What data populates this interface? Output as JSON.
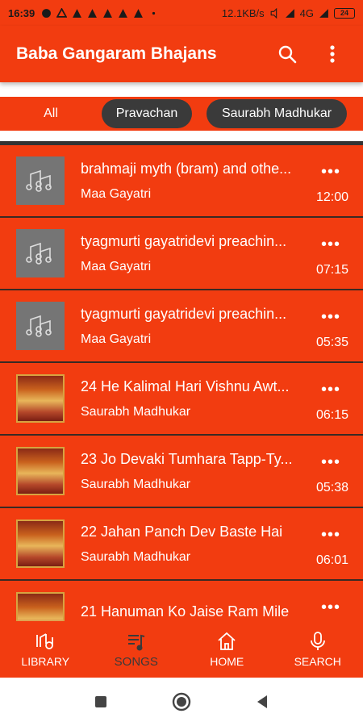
{
  "status": {
    "time": "16:39",
    "speed": "12.1KB/s",
    "network": "4G",
    "battery": "24"
  },
  "app": {
    "title": "Baba Gangaram Bhajans"
  },
  "filters": [
    "All",
    "Pravachan",
    "Saurabh Madhukar"
  ],
  "tracks": [
    {
      "title": "brahmaji myth (bram) and othe...",
      "artist": "Maa Gayatri",
      "duration": "12:00",
      "thumb": "music-note-icon"
    },
    {
      "title": "tyagmurti gayatridevi preachin...",
      "artist": "Maa Gayatri",
      "duration": "07:15",
      "thumb": "music-note-icon"
    },
    {
      "title": "tyagmurti gayatridevi preachin...",
      "artist": "Maa Gayatri",
      "duration": "05:35",
      "thumb": "music-note-icon"
    },
    {
      "title": "24 He Kalimal Hari Vishnu Awt...",
      "artist": "Saurabh Madhukar",
      "duration": "06:15",
      "thumb": "album-art"
    },
    {
      "title": "23 Jo Devaki Tumhara Tapp-Ty...",
      "artist": "Saurabh Madhukar",
      "duration": "05:38",
      "thumb": "album-art"
    },
    {
      "title": "22 Jahan Panch Dev Baste Hai",
      "artist": "Saurabh Madhukar",
      "duration": "06:01",
      "thumb": "album-art"
    },
    {
      "title": "21 Hanuman Ko Jaise Ram Mile",
      "artist": "",
      "duration": "",
      "thumb": "album-art"
    }
  ],
  "bottom_nav": {
    "library": "LIBRARY",
    "songs": "SONGS",
    "home": "HOME",
    "search": "SEARCH"
  },
  "colors": {
    "primary": "#f23c10",
    "chip_dark": "#3a3a3a",
    "thumb_generic": "#757575"
  }
}
